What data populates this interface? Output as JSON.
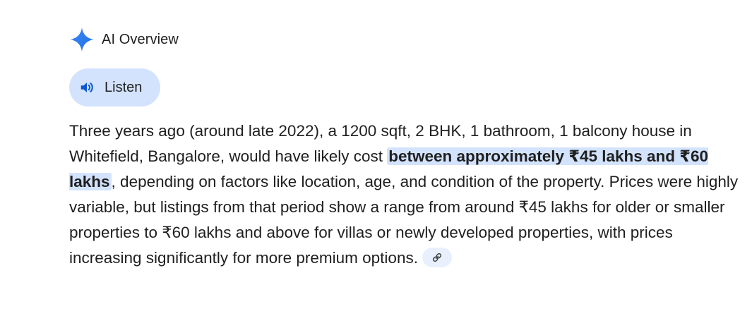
{
  "header": {
    "title": "AI Overview",
    "icon": "sparkle-icon",
    "icon_colors": [
      "#4285f4",
      "#1a73e8"
    ]
  },
  "listen": {
    "label": "Listen",
    "icon": "speaker-icon",
    "background": "#d3e3fd"
  },
  "overview": {
    "text_before": "Three years ago (around late 2022), a 1200 sqft, 2 BHK, 1 bathroom, 1 balcony house in Whitefield, Bangalore, would have likely cost ",
    "highlight": "between approximately ₹45 lakhs and ₹60 lakhs",
    "text_after": ", depending on factors like location, age, and condition of the property. Prices were highly variable, but listings from that period show a range from around ₹45 lakhs for older or smaller properties to ₹60 lakhs and above for villas or newly developed properties, with prices increasing significantly for more premium options.",
    "highlight_color": "#d3e3fd",
    "link_icon": "link-icon"
  }
}
